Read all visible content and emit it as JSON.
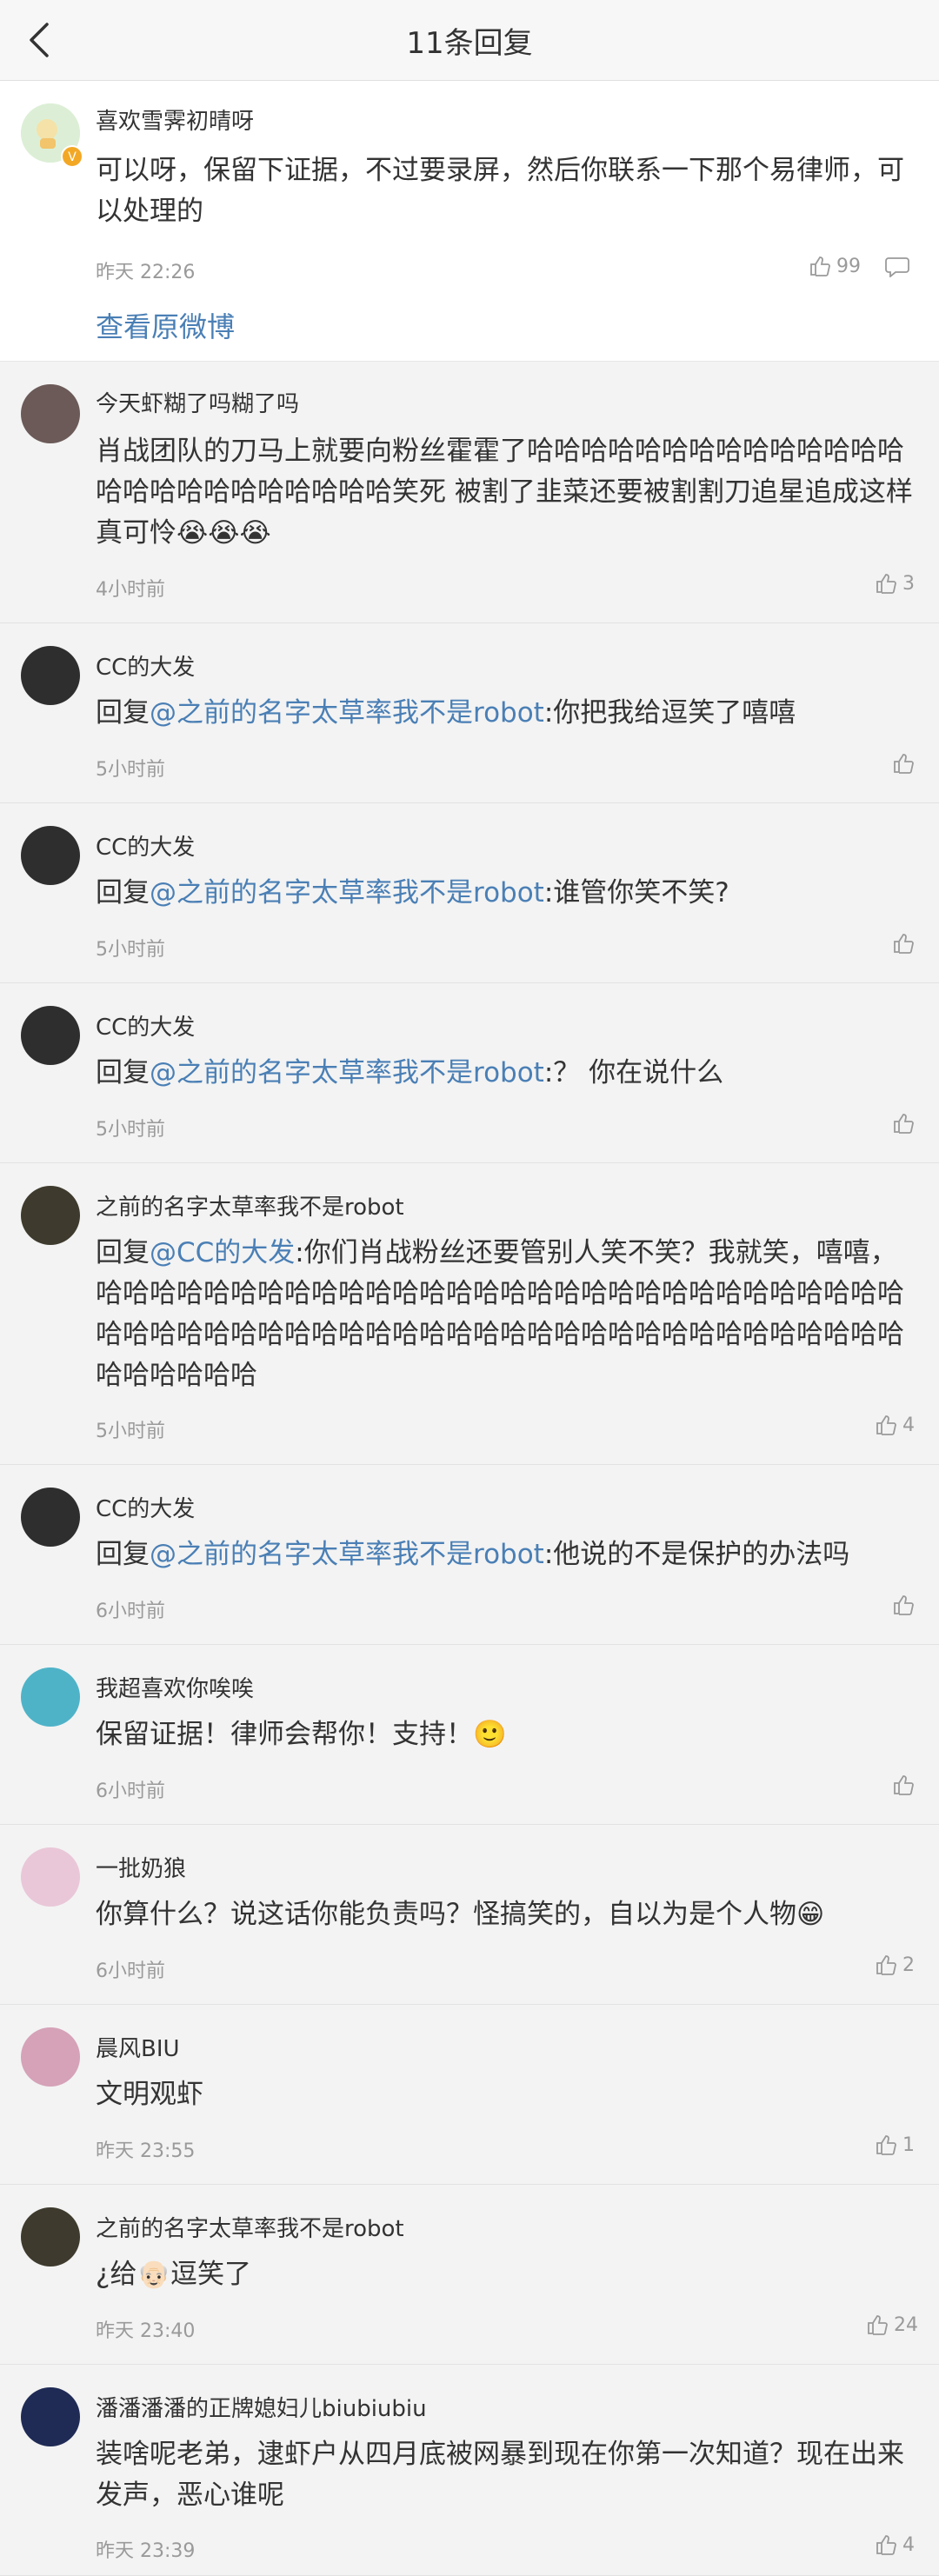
{
  "header": {
    "title": "11条回复"
  },
  "post": {
    "username": "喜欢雪霁初晴呀",
    "text": "可以呀，保留下证据，不过要录屏，然后你联系一下那个易律师，可以处理的",
    "time": "昨天 22:26",
    "likes": "99",
    "view_original": "查看原微博"
  },
  "replies": [
    {
      "username": "今天虾糊了吗糊了吗",
      "prefix": "",
      "mention": "",
      "text": "肖战团队的刀马上就要向粉丝霍霍了哈哈哈哈哈哈哈哈哈哈哈哈哈哈哈哈哈哈哈哈哈哈哈哈哈笑死 被割了韭菜还要被割割刀追星追成这样真可怜😭😭😭",
      "time": "4小时前",
      "likes": "3",
      "avatar_color": "#6b5a58"
    },
    {
      "username": "CC的大发",
      "prefix": "回复",
      "mention": "@之前的名字太草率我不是robot",
      "text": ":你把我给逗笑了嘻嘻",
      "time": "5小时前",
      "likes": "",
      "avatar_color": "#2e2e2e"
    },
    {
      "username": "CC的大发",
      "prefix": "回复",
      "mention": "@之前的名字太草率我不是robot",
      "text": ":谁管你笑不笑?",
      "time": "5小时前",
      "likes": "",
      "avatar_color": "#2e2e2e"
    },
    {
      "username": "CC的大发",
      "prefix": "回复",
      "mention": "@之前的名字太草率我不是robot",
      "text": ":？ 你在说什么",
      "time": "5小时前",
      "likes": "",
      "avatar_color": "#2e2e2e"
    },
    {
      "username": "之前的名字太草率我不是robot",
      "prefix": "回复",
      "mention": "@CC的大发",
      "text": ":你们肖战粉丝还要管别人笑不笑？我就笑，嘻嘻，哈哈哈哈哈哈哈哈哈哈哈哈哈哈哈哈哈哈哈哈哈哈哈哈哈哈哈哈哈哈哈哈哈哈哈哈哈哈哈哈哈哈哈哈哈哈哈哈哈哈哈哈哈哈哈哈哈哈哈哈哈哈哈哈哈哈",
      "time": "5小时前",
      "likes": "4",
      "avatar_color": "#3e3a2d"
    },
    {
      "username": "CC的大发",
      "prefix": "回复",
      "mention": "@之前的名字太草率我不是robot",
      "text": ":他说的不是保护的办法吗",
      "time": "6小时前",
      "likes": "",
      "avatar_color": "#2e2e2e"
    },
    {
      "username": "我超喜欢你唉唉",
      "prefix": "",
      "mention": "",
      "text": "保留证据！律师会帮你！支持！🙂",
      "time": "6小时前",
      "likes": "",
      "avatar_color": "#4fb3c8"
    },
    {
      "username": "一批奶狼",
      "prefix": "",
      "mention": "",
      "text": "你算什么？说这话你能负责吗？怪搞笑的，自以为是个人物😁",
      "time": "6小时前",
      "likes": "2",
      "avatar_color": "#e9c7d8"
    },
    {
      "username": "晨风BIU",
      "prefix": "",
      "mention": "",
      "text": "文明观虾",
      "time": "昨天 23:55",
      "likes": "1",
      "avatar_color": "#d5a2b8"
    },
    {
      "username": "之前的名字太草率我不是robot",
      "prefix": "",
      "mention": "",
      "text": "¿给👴🏻逗笑了",
      "time": "昨天 23:40",
      "likes": "24",
      "avatar_color": "#3e3a2d"
    },
    {
      "username": "潘潘潘潘的正牌媳妇儿biubiubiu",
      "prefix": "",
      "mention": "",
      "text": "装啥呢老弟，逮虾户从四月底被网暴到现在你第一次知道？现在出来发声，恶心谁呢",
      "time": "昨天 23:39",
      "likes": "4",
      "avatar_color": "#1f2b55"
    }
  ],
  "colors": {
    "link": "#4a7fb5",
    "meta": "#9a9a9a",
    "background": "#f2f2f2"
  }
}
